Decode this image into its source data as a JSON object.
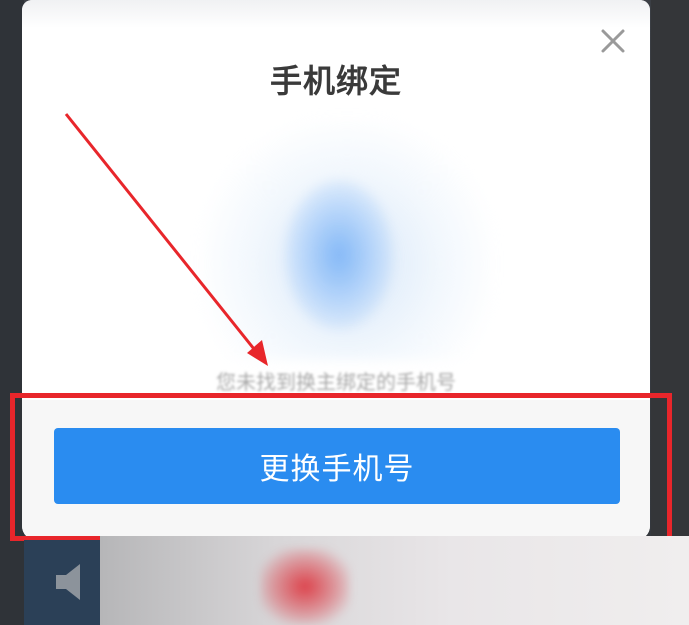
{
  "dialog": {
    "title": "手机绑定",
    "subtitle": "您未找到换主绑定的手机号",
    "change_button_label": "更换手机号"
  },
  "icons": {
    "close": "close-icon",
    "speaker": "speaker-icon",
    "illustration": "phone-illustration-icon"
  },
  "colors": {
    "primary": "#2a8cf0",
    "annotation": "#e8262b"
  }
}
